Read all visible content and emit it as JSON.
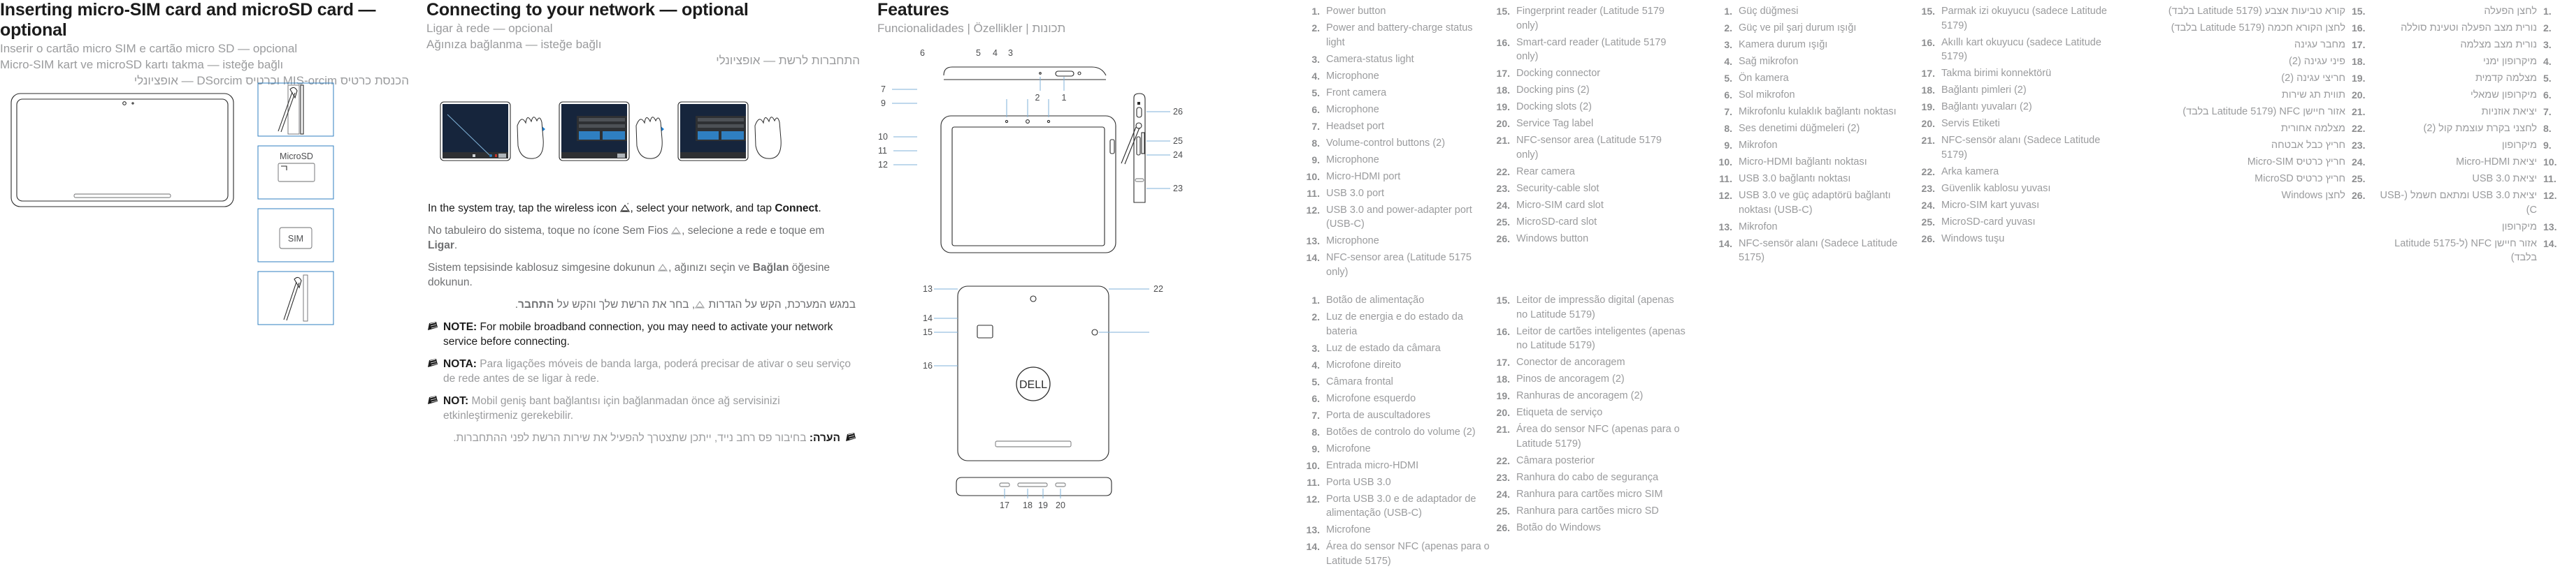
{
  "sections": {
    "sim": {
      "title": "Inserting micro-SIM card and microSD card — optional",
      "sub_pt": "Inserir o cartão micro SIM e cartão micro SD — opcional",
      "sub_tr": "Micro-SIM kart ve microSD kartı takma — isteğe bağlı",
      "sub_he": "הכנסת כרטיס micro-SIM וכרטיס microSD — אופציונלי",
      "labels": {
        "micro_sd": "MicroSD",
        "micro_sim": "SIM"
      }
    },
    "network": {
      "title": "Connecting to your network — optional",
      "sub_pt": "Ligar à rede — opcional",
      "sub_tr": "Ağınıza bağlanma — isteğe bağlı",
      "sub_he": "התחברות לרשת — אופציונלי",
      "step_en_a": "In the system tray, tap the wireless icon",
      "step_en_b": ", select your network, and tap ",
      "step_en_bold": "Connect",
      "step_en_c": ".",
      "step_pt_a": "No tabuleiro do sistema, toque no ícone Sem Fios",
      "step_pt_b": ", selecione a rede e toque em ",
      "step_pt_bold": "Ligar",
      "step_pt_c": ".",
      "step_tr_a": "Sistem tepsisinde kablosuz simgesine dokunun",
      "step_tr_b": ", ağınızı seçin ve ",
      "step_tr_bold": "Bağlan",
      "step_tr_c": " öğesine dokunun.",
      "step_he_a": "במגש המערכת, הקש על הגדרות",
      "step_he_b": ", בחר את הרשת שלך והקש על ",
      "step_he_bold": "התחבר",
      "step_he_c": ".",
      "note_en_label": "NOTE:",
      "note_en_text": "For mobile broadband connection, you may need to activate your network service before connecting.",
      "note_pt_label": "NOTA:",
      "note_pt_text": "Para ligações móveis de banda larga, poderá precisar de ativar o seu serviço de rede antes de se ligar à rede.",
      "note_tr_label": "NOT:",
      "note_tr_text": "Mobil geniş bant bağlantısı için bağlanmadan önce ağ servisinizi etkinleştirmeniz gerekebilir.",
      "note_he_label": "הערה:",
      "note_he_text": "בחיבור פס רחב נייד, ייתכן שתצטרך להפעיל את שירות הרשת לפני ההתחברות."
    },
    "features": {
      "title": "Features",
      "subtitle": "Funcionalidades | Özellikler | תכונות"
    }
  },
  "callouts": {
    "top_left_diagram": [
      "6",
      "5",
      "4",
      "3",
      "2",
      "1"
    ],
    "left_side": [
      "7",
      "9",
      "10",
      "11",
      "12"
    ],
    "right_side": [
      "26",
      "25",
      "24",
      "23"
    ],
    "back_left": [
      "13",
      "14",
      "15",
      "16"
    ],
    "back_right": [
      "22"
    ],
    "bottom_edge": [
      "17",
      "18",
      "19",
      "20"
    ]
  },
  "lists": {
    "en": [
      {
        "n": "1.",
        "t": "Power button"
      },
      {
        "n": "2.",
        "t": "Power and battery-charge status light"
      },
      {
        "n": "3.",
        "t": "Camera-status light"
      },
      {
        "n": "4.",
        "t": "Microphone"
      },
      {
        "n": "5.",
        "t": "Front camera"
      },
      {
        "n": "6.",
        "t": "Microphone"
      },
      {
        "n": "7.",
        "t": "Headset port"
      },
      {
        "n": "8.",
        "t": "Volume-control buttons (2)"
      },
      {
        "n": "9.",
        "t": "Microphone"
      },
      {
        "n": "10.",
        "t": "Micro-HDMI port"
      },
      {
        "n": "11.",
        "t": "USB 3.0 port"
      },
      {
        "n": "12.",
        "t": "USB 3.0 and power-adapter port (USB-C)"
      },
      {
        "n": "13.",
        "t": "Microphone"
      },
      {
        "n": "14.",
        "t": "NFC-sensor area (Latitude 5175 only)"
      },
      {
        "n": "15.",
        "t": "Fingerprint reader (Latitude 5179 only)"
      },
      {
        "n": "16.",
        "t": "Smart-card reader (Latitude 5179 only)"
      },
      {
        "n": "17.",
        "t": "Docking connector"
      },
      {
        "n": "18.",
        "t": "Docking pins (2)"
      },
      {
        "n": "19.",
        "t": "Docking slots (2)"
      },
      {
        "n": "20.",
        "t": "Service Tag label"
      },
      {
        "n": "21.",
        "t": "NFC-sensor area (Latitude 5179 only)"
      },
      {
        "n": "22.",
        "t": "Rear camera"
      },
      {
        "n": "23.",
        "t": "Security-cable slot"
      },
      {
        "n": "24.",
        "t": "Micro-SIM card slot"
      },
      {
        "n": "25.",
        "t": "MicroSD-card slot"
      },
      {
        "n": "26.",
        "t": "Windows button"
      }
    ],
    "tr": [
      {
        "n": "1.",
        "t": "Güç düğmesi"
      },
      {
        "n": "2.",
        "t": "Güç ve pil şarj durum ışığı"
      },
      {
        "n": "3.",
        "t": "Kamera durum ışığı"
      },
      {
        "n": "4.",
        "t": "Sağ mikrofon"
      },
      {
        "n": "5.",
        "t": "Ön kamera"
      },
      {
        "n": "6.",
        "t": "Sol mikrofon"
      },
      {
        "n": "7.",
        "t": "Mikrofonlu kulaklık bağlantı noktası"
      },
      {
        "n": "8.",
        "t": "Ses denetimi düğmeleri (2)"
      },
      {
        "n": "9.",
        "t": "Mikrofon"
      },
      {
        "n": "10.",
        "t": "Micro-HDMI bağlantı noktası"
      },
      {
        "n": "11.",
        "t": "USB 3.0 bağlantı noktası"
      },
      {
        "n": "12.",
        "t": "USB 3.0 ve güç adaptörü bağlantı noktası (USB-C)"
      },
      {
        "n": "13.",
        "t": "Mikrofon"
      },
      {
        "n": "14.",
        "t": "NFC-sensör alanı (Sadece Latitude 5175)"
      },
      {
        "n": "15.",
        "t": "Parmak izi okuyucu (sadece Latitude 5179)"
      },
      {
        "n": "16.",
        "t": "Akıllı kart okuyucu (sadece Latitude 5179)"
      },
      {
        "n": "17.",
        "t": "Takma birimi konnektörü"
      },
      {
        "n": "18.",
        "t": "Bağlantı pimleri (2)"
      },
      {
        "n": "19.",
        "t": "Bağlantı yuvaları (2)"
      },
      {
        "n": "20.",
        "t": "Servis Etiketi"
      },
      {
        "n": "21.",
        "t": "NFC-sensör alanı (Sadece Latitude 5179)"
      },
      {
        "n": "22.",
        "t": "Arka kamera"
      },
      {
        "n": "23.",
        "t": "Güvenlik kablosu yuvası"
      },
      {
        "n": "24.",
        "t": "Micro-SIM kart yuvası"
      },
      {
        "n": "25.",
        "t": "MicroSD-card yuvası"
      },
      {
        "n": "26.",
        "t": "Windows tuşu"
      }
    ],
    "he": [
      {
        "n": ".1",
        "t": "לחצן הפעלה"
      },
      {
        "n": ".2",
        "t": "נורית מצב הפעלה וטעינת סוללה"
      },
      {
        "n": ".3",
        "t": "נורית מצב מצלמה"
      },
      {
        "n": ".4",
        "t": "מיקרופון ימני"
      },
      {
        "n": ".5",
        "t": "מצלמה קדמית"
      },
      {
        "n": ".6",
        "t": "מיקרופון שמאלי"
      },
      {
        "n": ".7",
        "t": "יציאת אוזניות"
      },
      {
        "n": ".8",
        "t": "לחצני בקרת עוצמת קול (2)"
      },
      {
        "n": ".9",
        "t": "מיקרופון"
      },
      {
        "n": ".10",
        "t": "יציאת Micro-HDMI"
      },
      {
        "n": ".11",
        "t": "יציאת USB 3.0"
      },
      {
        "n": ".12",
        "t": "יציאת USB 3.0 ומתאם חשמל (USB-C)"
      },
      {
        "n": ".13",
        "t": "מיקרופון"
      },
      {
        "n": ".14",
        "t": "אזור חיישן NFC (ל-Latitude 5175 בלבד)"
      },
      {
        "n": ".15",
        "t": "קורא טביעות אצבע (Latitude 5179 בלבד)"
      },
      {
        "n": ".16",
        "t": "לחצן הקורא חכמה (Latitude 5179 בלבד)"
      },
      {
        "n": ".17",
        "t": "מחבר עגינה"
      },
      {
        "n": ".18",
        "t": "פיני עגינה (2)"
      },
      {
        "n": ".19",
        "t": "חריצי עגינה (2)"
      },
      {
        "n": ".20",
        "t": "תווית תג שירות"
      },
      {
        "n": ".21",
        "t": "אזור חיישן NFC (Latitude 5179 בלבד)"
      },
      {
        "n": ".22",
        "t": "מצלמה אחורית"
      },
      {
        "n": ".23",
        "t": "חריץ כבל אבטחה"
      },
      {
        "n": ".24",
        "t": "חריץ כרטיס Micro-SIM"
      },
      {
        "n": ".25",
        "t": "חריץ כרטיס MicroSD"
      },
      {
        "n": ".26",
        "t": "לחצן Windows"
      }
    ],
    "pt": [
      {
        "n": "1.",
        "t": "Botão de alimentação"
      },
      {
        "n": "2.",
        "t": "Luz de energia e do estado da bateria"
      },
      {
        "n": "3.",
        "t": "Luz de estado da câmara"
      },
      {
        "n": "4.",
        "t": "Microfone direito"
      },
      {
        "n": "5.",
        "t": "Câmara frontal"
      },
      {
        "n": "6.",
        "t": "Microfone esquerdo"
      },
      {
        "n": "7.",
        "t": "Porta de auscultadores"
      },
      {
        "n": "8.",
        "t": "Botões de controlo do volume (2)"
      },
      {
        "n": "9.",
        "t": "Microfone"
      },
      {
        "n": "10.",
        "t": "Entrada micro-HDMI"
      },
      {
        "n": "11.",
        "t": "Porta USB 3.0"
      },
      {
        "n": "12.",
        "t": "Porta USB 3.0 e de adaptador de alimentação (USB-C)"
      },
      {
        "n": "13.",
        "t": "Microfone"
      },
      {
        "n": "14.",
        "t": "Área do sensor NFC (apenas para o Latitude 5175)"
      },
      {
        "n": "15.",
        "t": "Leitor de impressão digital (apenas no Latitude 5179)"
      },
      {
        "n": "16.",
        "t": "Leitor de cartões inteligentes (apenas no Latitude 5179)"
      },
      {
        "n": "17.",
        "t": "Conector de ancoragem"
      },
      {
        "n": "18.",
        "t": "Pinos de ancoragem (2)"
      },
      {
        "n": "19.",
        "t": "Ranhuras de ancoragem (2)"
      },
      {
        "n": "20.",
        "t": "Etiqueta de serviço"
      },
      {
        "n": "21.",
        "t": "Área do sensor NFC (apenas para o Latitude 5179)"
      },
      {
        "n": "22.",
        "t": "Câmara posterior"
      },
      {
        "n": "23.",
        "t": "Ranhura do cabo de segurança"
      },
      {
        "n": "24.",
        "t": "Ranhura para cartões micro SIM"
      },
      {
        "n": "25.",
        "t": "Ranhura para cartões micro SD"
      },
      {
        "n": "26.",
        "t": "Botão do Windows"
      }
    ]
  },
  "colors": {
    "accent_blue": "#1a7fd4",
    "screen_navy": "#16253c",
    "heading": "#1b1b1b",
    "body_grey": "#9a9b9d"
  }
}
